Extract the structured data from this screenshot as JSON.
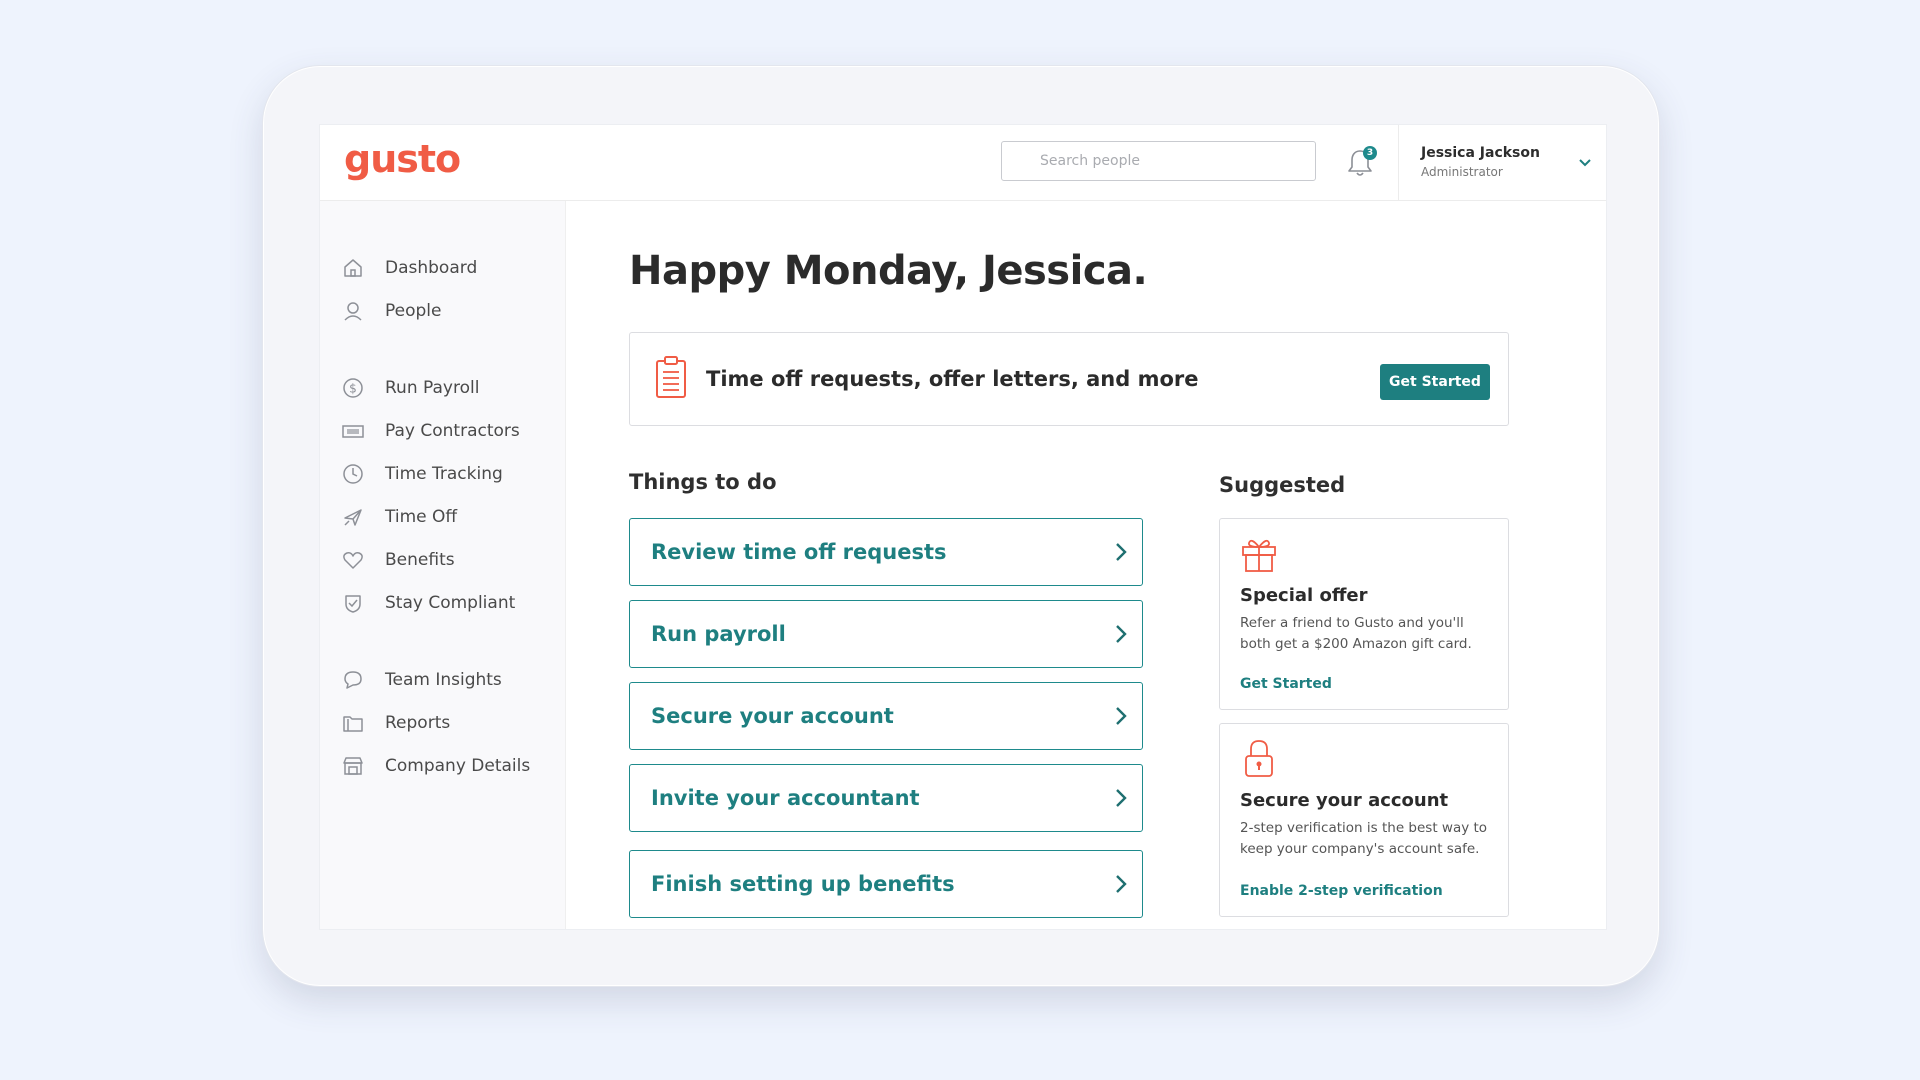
{
  "app": {
    "logo": "gusto"
  },
  "header": {
    "search_placeholder": "Search people",
    "notification_count": "3",
    "user_name": "Jessica Jackson",
    "user_role": "Administrator"
  },
  "sidebar": {
    "items": [
      {
        "label": "Dashboard",
        "icon": "home-icon"
      },
      {
        "label": "People",
        "icon": "person-icon"
      },
      {
        "label": "Run Payroll",
        "icon": "dollar-coin-icon"
      },
      {
        "label": "Pay Contractors",
        "icon": "cash-icon"
      },
      {
        "label": "Time Tracking",
        "icon": "clock-icon"
      },
      {
        "label": "Time Off",
        "icon": "airplane-icon"
      },
      {
        "label": "Benefits",
        "icon": "heart-icon"
      },
      {
        "label": "Stay Compliant",
        "icon": "shield-check-icon"
      },
      {
        "label": "Team Insights",
        "icon": "chat-bubble-icon"
      },
      {
        "label": "Reports",
        "icon": "folder-icon"
      },
      {
        "label": "Company Details",
        "icon": "storefront-icon"
      }
    ]
  },
  "main": {
    "greeting": "Happy Monday, Jessica.",
    "promo": {
      "text": "Time off requests, offer letters, and more",
      "button": "Get Started"
    },
    "todo": {
      "title": "Things to do",
      "items": [
        "Review time off requests",
        "Run payroll",
        "Secure your account",
        "Invite your accountant",
        "Finish setting up benefits"
      ]
    },
    "suggested": {
      "title": "Suggested",
      "cards": [
        {
          "title": "Special offer",
          "body": "Refer a friend to Gusto and you'll both get a $200 Amazon gift card.",
          "link": "Get Started",
          "icon": "gift-icon"
        },
        {
          "title": "Secure your account",
          "body": "2-step verification is the best way to keep your company's account safe.",
          "link": "Enable 2-step verification",
          "icon": "lock-icon"
        }
      ]
    }
  },
  "colors": {
    "brand": "#f05c45",
    "accent": "#1e7f80",
    "background": "#eef3fd"
  }
}
